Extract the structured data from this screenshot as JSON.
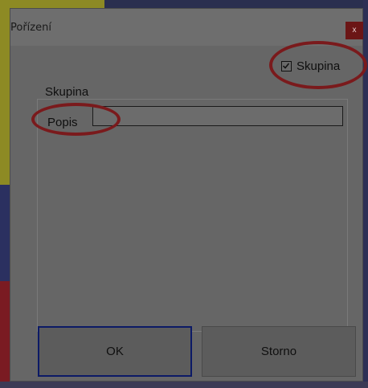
{
  "dialog": {
    "title": "Pořízení",
    "close_label": "x"
  },
  "skupina_checkbox": {
    "label": "Skupina",
    "checked": true
  },
  "group": {
    "legend": "Skupina",
    "popis_label": "Popis",
    "popis_value": ""
  },
  "buttons": {
    "ok": "OK",
    "storno": "Storno"
  },
  "colors": {
    "annotation": "#7a1a1c",
    "close_button": "#6b1616"
  }
}
